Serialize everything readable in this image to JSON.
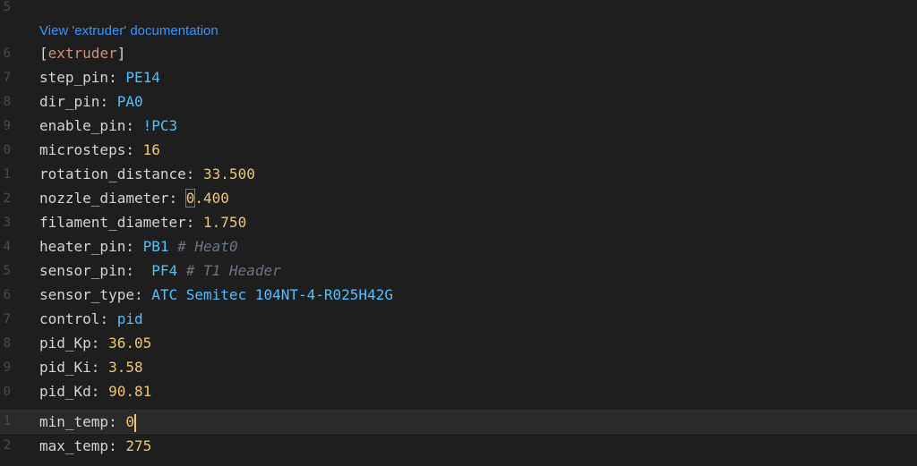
{
  "editor": {
    "doc_link": "View 'extruder' documentation",
    "gutter": [
      "5",
      "6",
      "7",
      "8",
      "9",
      "0",
      "1",
      "2",
      "3",
      "4",
      "5",
      "6",
      "7",
      "8",
      "9",
      "0",
      "1",
      "2"
    ],
    "section": "extruder",
    "lines": [
      {
        "key": "step_pin",
        "sep": ": ",
        "value": "PE14",
        "kind": "str",
        "comment": ""
      },
      {
        "key": "dir_pin",
        "sep": ": ",
        "value": "PA0",
        "kind": "str",
        "comment": ""
      },
      {
        "key": "enable_pin",
        "sep": ": ",
        "value": "!PC3",
        "kind": "str",
        "comment": ""
      },
      {
        "key": "microsteps",
        "sep": ": ",
        "value": "16",
        "kind": "num",
        "comment": ""
      },
      {
        "key": "rotation_distance",
        "sep": ": ",
        "value": "33.500",
        "kind": "num",
        "comment": ""
      },
      {
        "key": "nozzle_diameter",
        "sep": ": ",
        "value_hl": "0",
        "value": ".400",
        "kind": "num",
        "comment": ""
      },
      {
        "key": "filament_diameter",
        "sep": ": ",
        "value": "1.750",
        "kind": "num",
        "comment": ""
      },
      {
        "key": "heater_pin",
        "sep": ": ",
        "value": "PB1",
        "kind": "str",
        "comment": "# Heat0"
      },
      {
        "key": "sensor_pin",
        "sep": ":  ",
        "value": "PF4",
        "kind": "str",
        "comment": "# T1 Header"
      },
      {
        "key": "sensor_type",
        "sep": ": ",
        "value": "ATC Semitec 104NT-4-R025H42G",
        "kind": "str",
        "comment": ""
      },
      {
        "key": "control",
        "sep": ": ",
        "value": "pid",
        "kind": "str",
        "comment": ""
      },
      {
        "key": "pid_Kp",
        "sep": ": ",
        "value": "36.05",
        "kind": "num",
        "comment": ""
      },
      {
        "key": "pid_Ki",
        "sep": ": ",
        "value": "3.58",
        "kind": "num",
        "comment": ""
      },
      {
        "key": "pid_Kd",
        "sep": ": ",
        "value": "90.81",
        "kind": "num",
        "comment": ""
      },
      {
        "key": "min_temp",
        "sep": ": ",
        "value": "0",
        "kind": "num",
        "comment": ""
      },
      {
        "key": "max_temp",
        "sep": ": ",
        "value": "275",
        "kind": "num",
        "comment": ""
      }
    ]
  },
  "colors": {
    "background": "#1e1e1e",
    "key": "#d4d4d4",
    "section": "#ce9178",
    "string_value": "#4fc1ff",
    "number_value": "#f0c674",
    "comment": "#6a7585",
    "link": "#3794ff"
  }
}
